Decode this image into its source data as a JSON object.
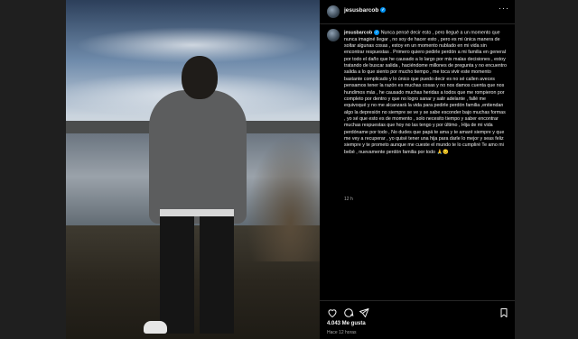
{
  "post": {
    "username": "jesusbarcob",
    "verified_mark": "✓",
    "more_label": "···",
    "caption_username": "jesusbarcob",
    "caption_text": "Nunca pensé decir esto , pero llegué a un momento que nunca imaginé llegar , no soy de hacer esto , pero es mi única manera de soltar algunas cosas , estoy en un momento nublado en mi vida sin encontrar respuestas . Primero quiero pedirle perdón a mi familia en general por todo el daño que he causado a lo largo por mis malas decisiones , estoy tratando de buscar salida , haciéndome millones de pregunta y no encuentro salida a lo que siento por mucho tiempo , me toca vivir este momento bastante complicado y lo único que puedo decir es no sé callen aveces pensamos tener la razón es muchas cosas y no nos damos cuenta que nos hundimos más , he causado muchas heridas a todos que me rompieron por completo por dentro y que no logro sanar y salir adelante , fallé me equivoqué y no me alcanzará la vida para pedirle perdón familia ,entiendan algo la depresión no siempre se ve y se sabe esconder bajo muchas formas , yo sé que esto es de momento , solo necesito tiempo y saber encontrar muchas respuestas que hoy no las tengo y por último , Hija de mi vida perdóname por todo , No dudes que papá te ama y te amaré siempre y que me vey a recuperar , yo quisé tener una hija para darle lo mejor y seas feliz siempre y te prometo aunque me cueste el mundo te lo cumpliré Te amo mi bebé , nuevamente perdón familia por todo 🙏😔",
    "caption_time": "12 h",
    "likes": "4.043 Me gusta",
    "time_ago": "Hace 12 horas"
  },
  "icons": [
    "heart-icon",
    "comment-icon",
    "share-icon",
    "bookmark-icon",
    "more-options-icon",
    "verified-badge-icon"
  ],
  "colors": {
    "panel_bg": "#000000",
    "verified": "#0095f6",
    "muted_text": "#a8a8a8"
  }
}
